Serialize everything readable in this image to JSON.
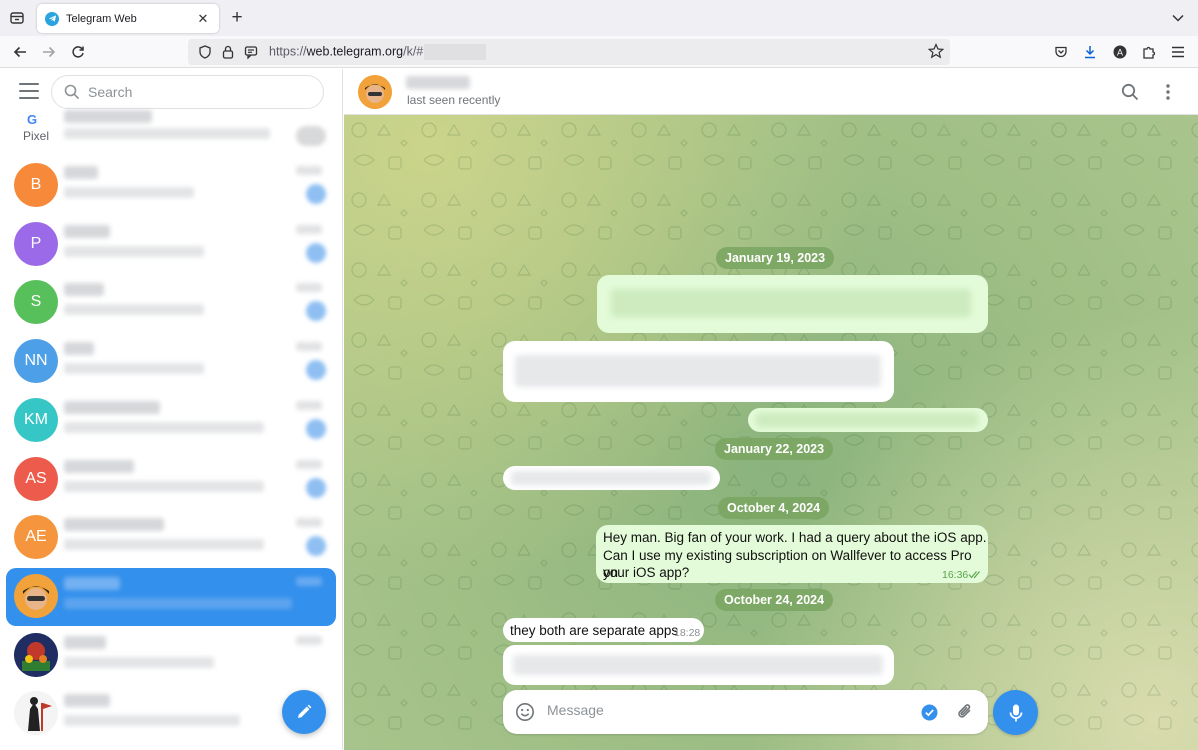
{
  "browser": {
    "tab_title": "Telegram Web",
    "tab_close": "✕",
    "new_tab": "+",
    "url_prefix": "https://",
    "url_domain": "web.telegram.org",
    "url_path": "/k/#"
  },
  "sidebar": {
    "search_placeholder": "Search",
    "pinned_label": "Pixel",
    "pinned_logo": "G",
    "chats": [
      {
        "initials": "B",
        "color": "#f7893a"
      },
      {
        "initials": "P",
        "color": "#9b6ae8"
      },
      {
        "initials": "S",
        "color": "#57c05a"
      },
      {
        "initials": "NN",
        "color": "#4d9fe8"
      },
      {
        "initials": "KM",
        "color": "#37c6c6"
      },
      {
        "initials": "AS",
        "color": "#ec5b4b"
      },
      {
        "initials": "AE",
        "color": "#f5963e"
      },
      {
        "initials": "",
        "color": "#f2a23a"
      },
      {
        "initials": "",
        "color": "#2b3a6e"
      },
      {
        "initials": "",
        "color": "#eeeeee"
      }
    ]
  },
  "chat": {
    "status": "last seen recently",
    "dates": [
      "January 19, 2023",
      "January 22, 2023",
      "October 4, 2024",
      "October 24, 2024"
    ],
    "message_out": {
      "text_line1": "Hey man. Big fan of your work. I had a query about the iOS app.",
      "text_line2": "Can I use my existing subscription on Wallfever to access Pro on",
      "text_line3": "your iOS app?",
      "time": "16:36"
    },
    "message_in": {
      "text": "they both are separate apps",
      "time": "18:28"
    },
    "composer_placeholder": "Message"
  },
  "colors": {
    "accent": "#3390ec",
    "outgoing_bubble": "#e3fbd8",
    "date_pill": "#79a560"
  }
}
